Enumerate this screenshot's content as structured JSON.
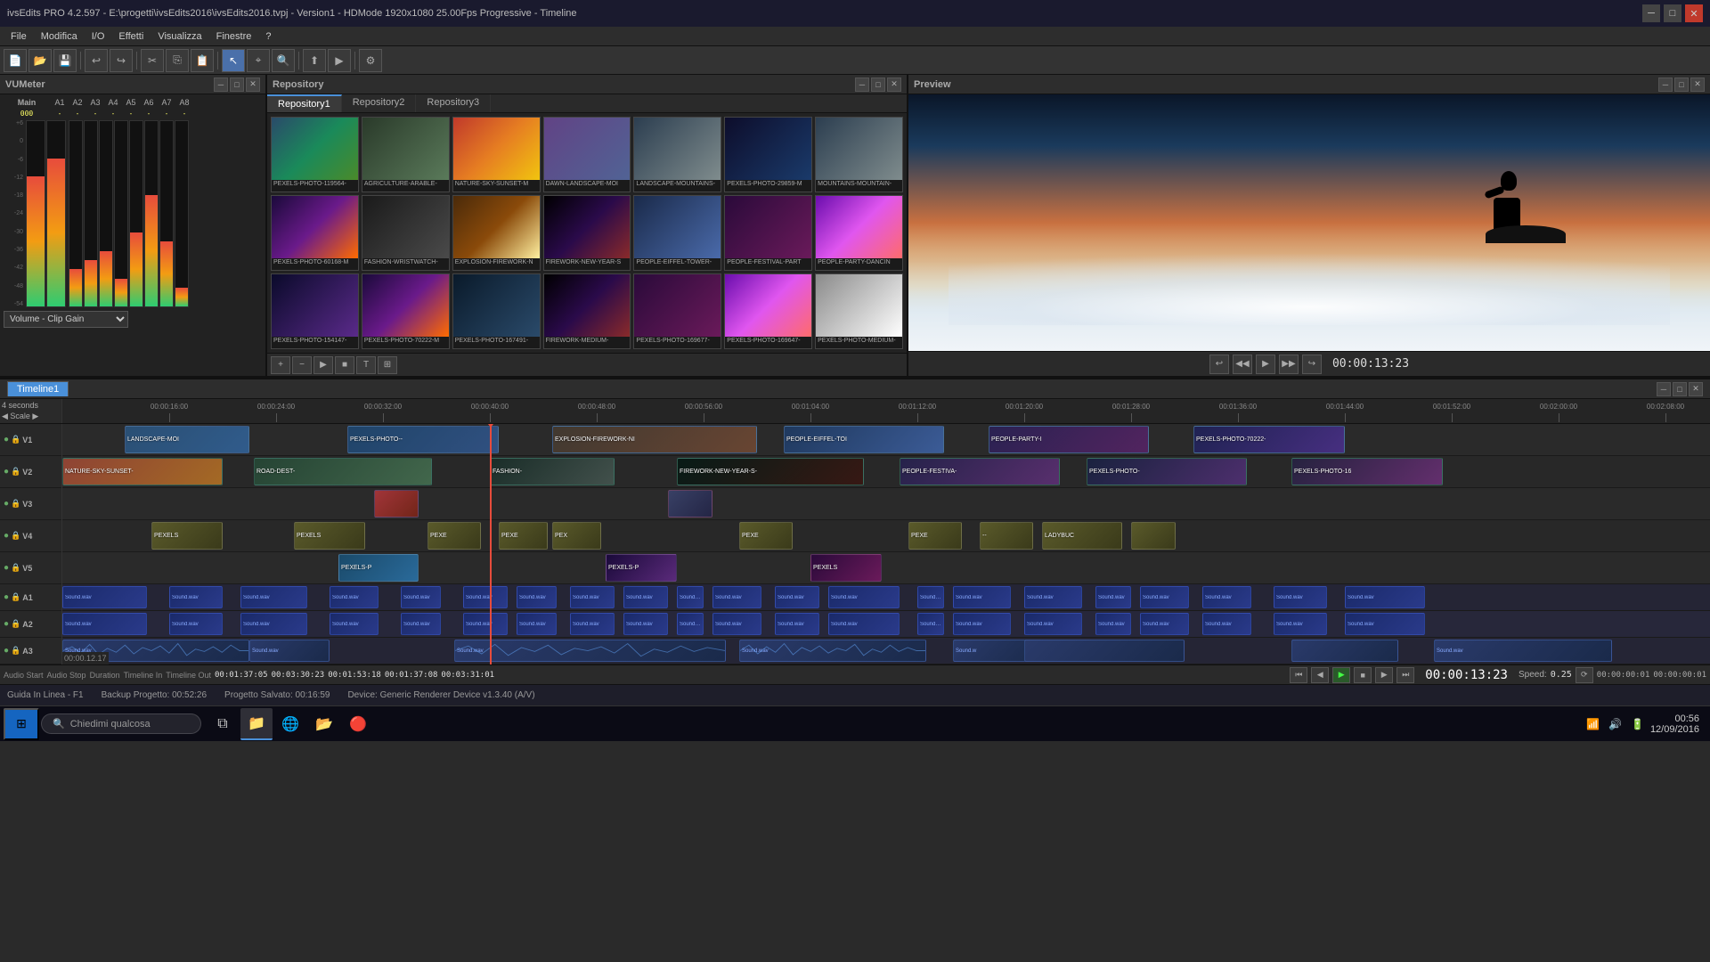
{
  "titleBar": {
    "title": "ivsEdits PRO 4.2.597 - E:\\progetti\\ivsEdits2016\\ivsEdits2016.tvpj - Version1 - HDMode 1920x1080 25.00Fps Progressive - Timeline"
  },
  "menuBar": {
    "items": [
      "File",
      "Modifica",
      "I/O",
      "Effetti",
      "Visualizza",
      "Finestre",
      "?"
    ]
  },
  "panels": {
    "vuMeter": {
      "title": "VUMeter"
    },
    "repository": {
      "title": "Repository",
      "tabs": [
        "Repository1",
        "Repository2",
        "Repository3"
      ]
    },
    "preview": {
      "title": "Preview",
      "timecode": "00:00:13:23"
    }
  },
  "timeline": {
    "title": "Timeline",
    "tab": "Timeline1",
    "scale": "4 seconds",
    "timecodeMain": "00:00:13:23",
    "speed": "0.25",
    "inPoint": "00:00:00:01",
    "outPoint": "00:00:00:01",
    "audioStart": "00:01:37:05",
    "audioStop": "00:03:30:23",
    "duration": "00:01:53:18",
    "timelineIn": "00:01:37:08",
    "timelineOut": "00:03:31:01",
    "tracks": [
      {
        "name": "V1",
        "type": "video"
      },
      {
        "name": "V2",
        "type": "video"
      },
      {
        "name": "V3",
        "type": "video"
      },
      {
        "name": "V4",
        "type": "video"
      },
      {
        "name": "V5",
        "type": "video"
      },
      {
        "name": "A1",
        "type": "audio"
      },
      {
        "name": "A2",
        "type": "audio"
      },
      {
        "name": "A3",
        "type": "audio"
      }
    ],
    "rulerMarks": [
      "00:00:16:00",
      "00:00:24:00",
      "00:00:32:00",
      "00:00:40:00",
      "00:00:48:00",
      "00:00:56:00",
      "00:01:04:00",
      "00:01:12:00",
      "00:01:20:00",
      "00:01:28:00",
      "00:01:36:00",
      "00:01:44:00",
      "00:01:52:00",
      "00:02:00:00",
      "00:02:08:00"
    ]
  },
  "statusBar": {
    "guide": "Guida In Linea - F1",
    "backup": "Backup Progetto: 00:52:26",
    "saved": "Progetto Salvato: 00:16:59",
    "device": "Device: Generic Renderer Device v1.3.40 (A/V)"
  },
  "taskbar": {
    "search": "Chiedimi qualcosa",
    "clock": "00:56",
    "date": "12/09/2016"
  },
  "mediaItems": [
    {
      "label": "PEXELS-PHOTO-119564-",
      "thumb": "thumb-landscape"
    },
    {
      "label": "AGRICULTURE-ARABLE-",
      "thumb": "thumb-road"
    },
    {
      "label": "NATURE-SKY-SUNSET-M",
      "thumb": "thumb-sunset"
    },
    {
      "label": "DAWN-LANDSCAPE-MOI",
      "thumb": "thumb-dawn"
    },
    {
      "label": "LANDSCAPE-MOUNTAINS-",
      "thumb": "thumb-mountains"
    },
    {
      "label": "PEXELS-PHOTO-29859-M",
      "thumb": "thumb-night"
    },
    {
      "label": "MOUNTAINS-MOUNTAIN-",
      "thumb": "thumb-mountains"
    },
    {
      "label": "PEXELS-PHOTO-60168-M",
      "thumb": "thumb-concert"
    },
    {
      "label": "FASHION-WRISTWATCH-",
      "thumb": "thumb-fashion"
    },
    {
      "label": "EXPLOSION-FIREWORK-N",
      "thumb": "thumb-explosion"
    },
    {
      "label": "FIREWORK-NEW-YEAR-S",
      "thumb": "thumb-firework"
    },
    {
      "label": "PEOPLE-EIFFEL-TOWER-",
      "thumb": "thumb-tower"
    },
    {
      "label": "PEOPLE-FESTIVAL-PART",
      "thumb": "thumb-people"
    },
    {
      "label": "PEOPLE-PARTY-DANCIN",
      "thumb": "thumb-party"
    },
    {
      "label": "PEXELS-PHOTO-154147-",
      "thumb": "thumb-disco"
    },
    {
      "label": "PEXELS-PHOTO-70222-M",
      "thumb": "thumb-concert"
    },
    {
      "label": "PEXELS-PHOTO-167491-",
      "thumb": "thumb-city"
    },
    {
      "label": "FIREWORK-MEDIUM-",
      "thumb": "thumb-firework"
    },
    {
      "label": "PEXELS-PHOTO-169677-",
      "thumb": "thumb-people"
    },
    {
      "label": "PEXELS-PHOTO-169647-",
      "thumb": "thumb-party"
    },
    {
      "label": "PEXELS-PHOTO-MEDIUM-",
      "thumb": "thumb-white"
    }
  ],
  "vuScale": [
    "+6",
    "0",
    "-6",
    "-12",
    "-18",
    "-24",
    "-30",
    "-36",
    "-42",
    "-48",
    "-54"
  ],
  "audioClipLabel": "Sound.wav",
  "volumeLabel": "Volume - Clip Gain"
}
